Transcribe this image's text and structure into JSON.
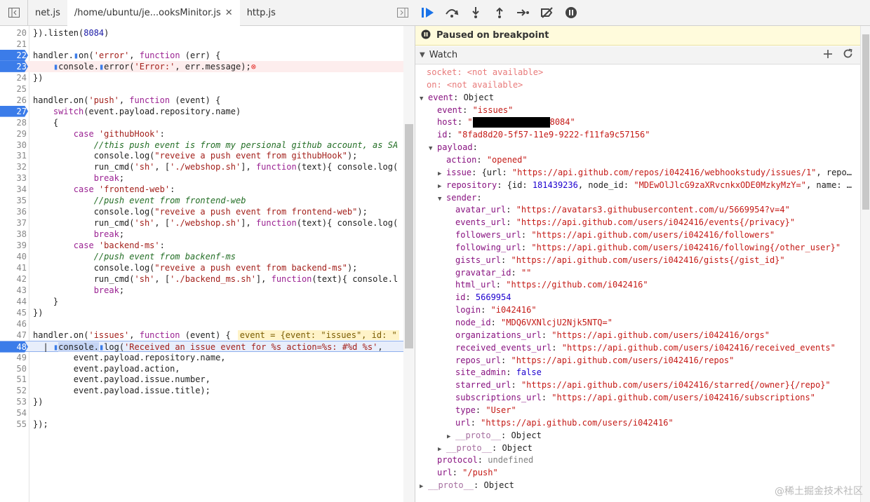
{
  "tabs": [
    {
      "label": "net.js"
    },
    {
      "label": "/home/ubuntu/je...ooksMinitor.js",
      "close": "✕"
    },
    {
      "label": "http.js"
    }
  ],
  "code_lines": [
    {
      "n": "20",
      "html": "}).listen(<span class='num'>8084</span>)"
    },
    {
      "n": "21",
      "html": ""
    },
    {
      "n": "22",
      "html": "handler.<span style='color:#3b7ce9'>▮</span>on(<span class='str'>'error'</span>, <span class='kw'>function</span> (err) {",
      "bp": true
    },
    {
      "n": "23",
      "html": "    <span style='color:#3b7ce9'>▮</span>console.<span style='color:#3b7ce9'>▮</span>error(<span class='str'>'Error:'</span>, err.message);<span style='color:#e53935'>⊗</span>",
      "bp": true,
      "err": true
    },
    {
      "n": "24",
      "html": "})"
    },
    {
      "n": "25",
      "html": ""
    },
    {
      "n": "26",
      "html": "handler.on(<span class='str'>'push'</span>, <span class='kw'>function</span> (event) {"
    },
    {
      "n": "27",
      "html": "    <span class='kw'>switch</span>(event.payload.repository.name)",
      "bp": true
    },
    {
      "n": "28",
      "html": "    {"
    },
    {
      "n": "29",
      "html": "        <span class='kw'>case</span> <span class='str'>'githubHook'</span>:"
    },
    {
      "n": "30",
      "html": "            <span class='cmt'>//this push event is from my persional github account, as SA</span>"
    },
    {
      "n": "31",
      "html": "            console.log(<span class='str'>\"reveive a push event from githubHook\"</span>);"
    },
    {
      "n": "32",
      "html": "            run_cmd(<span class='str'>'sh'</span>, [<span class='str'>'./webshop.sh'</span>], <span class='kw'>function</span>(text){ console.log("
    },
    {
      "n": "33",
      "html": "            <span class='kw'>break</span>;"
    },
    {
      "n": "34",
      "html": "        <span class='kw'>case</span> <span class='str'>'frontend-web'</span>:"
    },
    {
      "n": "35",
      "html": "            <span class='cmt'>//push event from frontend-web</span>"
    },
    {
      "n": "36",
      "html": "            console.log(<span class='str'>\"reveive a push event from frontend-web\"</span>);"
    },
    {
      "n": "37",
      "html": "            run_cmd(<span class='str'>'sh'</span>, [<span class='str'>'./webshop.sh'</span>], <span class='kw'>function</span>(text){ console.log("
    },
    {
      "n": "38",
      "html": "            <span class='kw'>break</span>;"
    },
    {
      "n": "39",
      "html": "        <span class='kw'>case</span> <span class='str'>'backend-ms'</span>:"
    },
    {
      "n": "40",
      "html": "            <span class='cmt'>//push event from backenf-ms</span>"
    },
    {
      "n": "41",
      "html": "            console.log(<span class='str'>\"reveive a push event from backend-ms\"</span>);"
    },
    {
      "n": "42",
      "html": "            run_cmd(<span class='str'>'sh'</span>, [<span class='str'>'./backend_ms.sh'</span>], <span class='kw'>function</span>(text){ console.l"
    },
    {
      "n": "43",
      "html": "            <span class='kw'>break</span>;"
    },
    {
      "n": "44",
      "html": "    }"
    },
    {
      "n": "45",
      "html": "})"
    },
    {
      "n": "46",
      "html": ""
    },
    {
      "n": "47",
      "html": "handler.on(<span class='str'>'issues'</span>, <span class='kw'>function</span> (event) {<span class='inline-val'>event = {event: \"issues\", id: \"</span>"
    },
    {
      "n": "48",
      "html": "  | <span style='color:#3b7ce9'>▮</span><span style='background:#c5d5f5'>console.</span><span style='color:#3b7ce9'>▮</span>log(<span class='str'>'Received an issue event for %s action=%s: #%d %s'</span>,",
      "bp": true,
      "exec": true
    },
    {
      "n": "49",
      "html": "        event.payload.repository.name,"
    },
    {
      "n": "50",
      "html": "        event.payload.action,"
    },
    {
      "n": "51",
      "html": "        event.payload.issue.number,"
    },
    {
      "n": "52",
      "html": "        event.payload.issue.title);"
    },
    {
      "n": "53",
      "html": "})"
    },
    {
      "n": "54",
      "html": ""
    },
    {
      "n": "55",
      "html": "});"
    }
  ],
  "paused_text": "Paused on breakpoint",
  "watch_label": "Watch",
  "watch_rows": [
    {
      "indent": 0,
      "html": "<span class='na'>socket: &lt;not available&gt;</span>",
      "noarrow": true,
      "pad": 16
    },
    {
      "indent": 0,
      "html": "<span class='na'>on: &lt;not available&gt;</span>",
      "noarrow": true,
      "pad": 16
    },
    {
      "indent": 0,
      "arrow": "▼",
      "html": "<span class='k'>event</span><span class='o'>: Object</span>"
    },
    {
      "indent": 1,
      "html": "<span class='k'>event</span><span class='o'>: </span><span class='s'>\"issues\"</span>"
    },
    {
      "indent": 1,
      "html": "<span class='k'>host</span><span class='o'>: </span><span class='s'>\"<span class='redact'></span>8084\"</span>"
    },
    {
      "indent": 1,
      "html": "<span class='k'>id</span><span class='o'>: </span><span class='s'>\"8fad8d20-5f57-11e9-9222-f11fa9c57156\"</span>"
    },
    {
      "indent": 1,
      "arrow": "▼",
      "html": "<span class='k'>payload</span><span class='o'>:</span>"
    },
    {
      "indent": 2,
      "html": "<span class='k'>action</span><span class='o'>: </span><span class='s'>\"opened\"</span>"
    },
    {
      "indent": 2,
      "arrow": "▶",
      "html": "<span class='k'>issue</span><span class='o'>: {url: </span><span class='s'>\"https://api.github.com/repos/i042416/webhookstudy/issues/1\"</span><span class='o'>, repo…</span>"
    },
    {
      "indent": 2,
      "arrow": "▶",
      "html": "<span class='k'>repository</span><span class='o'>: {id: </span><span class='n'>181439236</span><span class='o'>, node_id: </span><span class='s'>\"MDEwOlJlcG9zaXRvcnkxODE0MzkyMzY=\"</span><span class='o'>, name: …</span>"
    },
    {
      "indent": 2,
      "arrow": "▼",
      "html": "<span class='k'>sender</span><span class='o'>:</span>"
    },
    {
      "indent": 3,
      "html": "<span class='k'>avatar_url</span><span class='o'>: </span><span class='s'>\"https://avatars3.githubusercontent.com/u/5669954?v=4\"</span>"
    },
    {
      "indent": 3,
      "html": "<span class='k'>events_url</span><span class='o'>: </span><span class='s'>\"https://api.github.com/users/i042416/events{/privacy}\"</span>"
    },
    {
      "indent": 3,
      "html": "<span class='k'>followers_url</span><span class='o'>: </span><span class='s'>\"https://api.github.com/users/i042416/followers\"</span>"
    },
    {
      "indent": 3,
      "html": "<span class='k'>following_url</span><span class='o'>: </span><span class='s'>\"https://api.github.com/users/i042416/following{/other_user}\"</span>"
    },
    {
      "indent": 3,
      "html": "<span class='k'>gists_url</span><span class='o'>: </span><span class='s'>\"https://api.github.com/users/i042416/gists{/gist_id}\"</span>"
    },
    {
      "indent": 3,
      "html": "<span class='k'>gravatar_id</span><span class='o'>: </span><span class='s'>\"\"</span>"
    },
    {
      "indent": 3,
      "html": "<span class='k'>html_url</span><span class='o'>: </span><span class='s'>\"https://github.com/i042416\"</span>"
    },
    {
      "indent": 3,
      "html": "<span class='k'>id</span><span class='o'>: </span><span class='n'>5669954</span>"
    },
    {
      "indent": 3,
      "html": "<span class='k'>login</span><span class='o'>: </span><span class='s'>\"i042416\"</span>"
    },
    {
      "indent": 3,
      "html": "<span class='k'>node_id</span><span class='o'>: </span><span class='s'>\"MDQ6VXNlcjU2Njk5NTQ=\"</span>"
    },
    {
      "indent": 3,
      "html": "<span class='k'>organizations_url</span><span class='o'>: </span><span class='s'>\"https://api.github.com/users/i042416/orgs\"</span>"
    },
    {
      "indent": 3,
      "html": "<span class='k'>received_events_url</span><span class='o'>: </span><span class='s'>\"https://api.github.com/users/i042416/received_events\"</span>"
    },
    {
      "indent": 3,
      "html": "<span class='k'>repos_url</span><span class='o'>: </span><span class='s'>\"https://api.github.com/users/i042416/repos\"</span>"
    },
    {
      "indent": 3,
      "html": "<span class='k'>site_admin</span><span class='o'>: </span><span class='n'>false</span>"
    },
    {
      "indent": 3,
      "html": "<span class='k'>starred_url</span><span class='o'>: </span><span class='s'>\"https://api.github.com/users/i042416/starred{/owner}{/repo}\"</span>"
    },
    {
      "indent": 3,
      "html": "<span class='k'>subscriptions_url</span><span class='o'>: </span><span class='s'>\"https://api.github.com/users/i042416/subscriptions\"</span>"
    },
    {
      "indent": 3,
      "html": "<span class='k'>type</span><span class='o'>: </span><span class='s'>\"User\"</span>"
    },
    {
      "indent": 3,
      "html": "<span class='k'>url</span><span class='o'>: </span><span class='s'>\"https://api.github.com/users/i042416\"</span>"
    },
    {
      "indent": 3,
      "arrow": "▶",
      "html": "<span class='k dim'>__proto__</span><span class='o'>: Object</span>"
    },
    {
      "indent": 2,
      "arrow": "▶",
      "html": "<span class='k dim'>__proto__</span><span class='o'>: Object</span>"
    },
    {
      "indent": 1,
      "html": "<span class='k'>protocol</span><span class='o'>: </span><span class='u'>undefined</span>"
    },
    {
      "indent": 1,
      "html": "<span class='k'>url</span><span class='o'>: </span><span class='s'>\"/push\"</span>"
    },
    {
      "indent": 0,
      "arrow": "▶",
      "html": "<span class='k dim'>__proto__</span><span class='o'>: Object</span>"
    }
  ],
  "watermark": "@稀土掘金技术社区"
}
